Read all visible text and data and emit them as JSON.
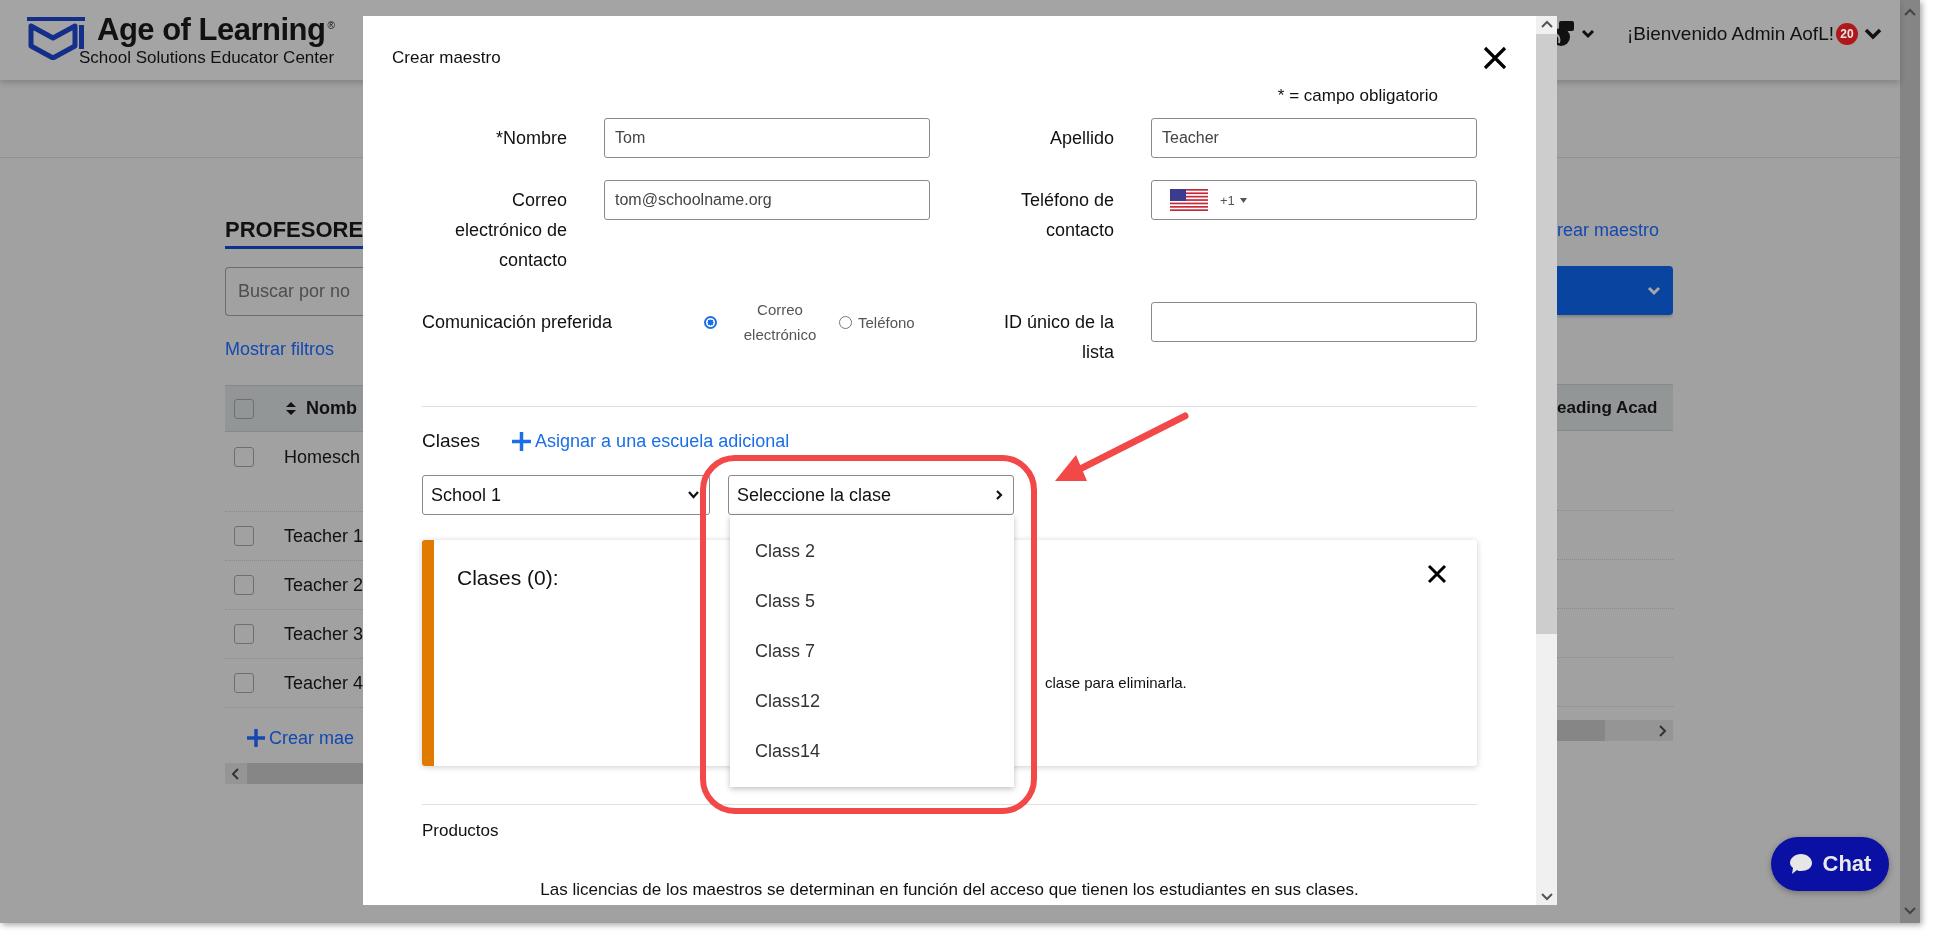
{
  "header": {
    "logo_title": "Age of Learning",
    "logo_mark": "®",
    "logo_subtitle": "School Solutions Educator Center",
    "welcome": "¡Bienvenido Admin AofL!",
    "notification_count": "20"
  },
  "page": {
    "heading": "PROFESORE",
    "search": {
      "placeholder": "Buscar por no"
    },
    "filters_link": "Mostrar filtros",
    "create_link_top": "rear maestro",
    "table": {
      "select_all_checked": false,
      "columns": [
        "Nomb",
        "eading Acad"
      ],
      "rows": [
        {
          "name": "Homesch",
          "checked": false
        },
        {
          "name": "Teacher 1",
          "checked": false
        },
        {
          "name": "Teacher 2",
          "checked": false
        },
        {
          "name": "Teacher 3",
          "checked": false
        },
        {
          "name": "Teacher 4",
          "checked": false
        }
      ]
    },
    "create_link_bottom": "Crear mae"
  },
  "modal": {
    "title": "Crear maestro",
    "required_note": "* = campo obligatorio",
    "fields": [
      {
        "kind": "text",
        "label": "*Nombre",
        "value": "Tom"
      },
      {
        "kind": "text",
        "label": "Apellido",
        "value": "Teacher"
      },
      {
        "kind": "text",
        "label": "Correo electrónico de contacto",
        "value": "tom@schoolname.org"
      },
      {
        "kind": "phone",
        "label": "Teléfono de contacto",
        "value": "+1"
      }
    ],
    "preferred_contact": {
      "label": "Comunicación preferida",
      "options": [
        {
          "label": "Correo electrónico",
          "selected": true
        },
        {
          "label": "Teléfono",
          "selected": false
        }
      ]
    },
    "list_id": {
      "label": "ID único de la lista"
    },
    "classes": {
      "label": "Clases",
      "add_school_link": "Asignar a una escuela adicional",
      "school_select": "School 1",
      "class_select": "Seleccione la clase",
      "class_options": [
        "Class 2",
        "Class 5",
        "Class 7",
        "Class12",
        "Class14"
      ],
      "summary_title": "Clases (0):",
      "summary_hint": "clase para eliminarla."
    },
    "products": {
      "label": "Productos",
      "note": "Las licencias de los maestros se determinan en función del acceso que tienen los estudiantes en sus clases."
    }
  },
  "chat_button": "Chat"
}
